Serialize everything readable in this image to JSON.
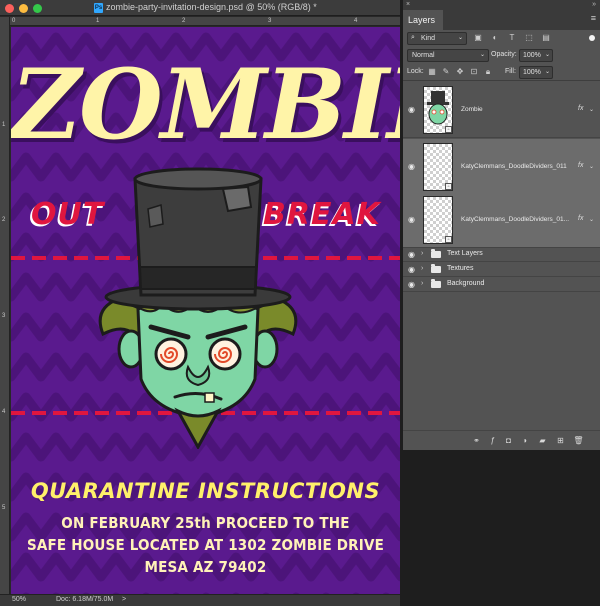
{
  "window": {
    "doc_icon": "Ps",
    "title": "zombie-party-invitation-design.psd @ 50% (RGB/8) *"
  },
  "rulers": {
    "top": [
      "0",
      "1",
      "2",
      "3",
      "4"
    ],
    "left": [
      "1",
      "2",
      "3",
      "4",
      "5"
    ]
  },
  "canvas": {
    "title": "ZOMBIE",
    "out": "OUT",
    "break": "BREAK",
    "heading": "QUARANTINE INSTRUCTIONS",
    "line1": "ON FEBRUARY 25th PROCEED TO THE",
    "line2": "SAFE HOUSE LOCATED AT 1302 ZOMBIE DRIVE",
    "line3": "MESA AZ 79402",
    "colors": {
      "background": "#5a1a8e",
      "title": "#fff4a8",
      "accent_red": "#e0163f",
      "heading_yellow": "#fff06a",
      "zombie_skin": "#7fd6a5"
    }
  },
  "status": {
    "zoom": "50%",
    "doc": "Doc: 6.18M/75.0M",
    "arrow": ">"
  },
  "layers_panel": {
    "tab": "Layers",
    "close": "×",
    "collapse": "»",
    "menu": "≡",
    "filter_kind": "Kind",
    "blend_mode": "Normal",
    "opacity_label": "Opacity:",
    "opacity_value": "100%",
    "lock_label": "Lock:",
    "fill_label": "Fill:",
    "fill_value": "100%",
    "layers": [
      {
        "name": "Zombie",
        "type": "smart-object",
        "visible": true,
        "fx": "fx"
      },
      {
        "name": "KatyClemmans_DoodleDividers_011",
        "type": "smart-object",
        "visible": true,
        "fx": "fx"
      },
      {
        "name": "KatyClemmans_DoodleDividers_01...",
        "type": "smart-object",
        "visible": true,
        "fx": "fx"
      }
    ],
    "groups": [
      {
        "name": "Text Layers",
        "visible": true
      },
      {
        "name": "Textures",
        "visible": true
      },
      {
        "name": "Background",
        "visible": true
      }
    ],
    "icons": {
      "footer": [
        "link-layers-icon",
        "fx-icon",
        "add-mask-icon",
        "adjustment-layer-icon",
        "new-group-icon",
        "new-layer-icon",
        "delete-layer-icon"
      ]
    }
  }
}
